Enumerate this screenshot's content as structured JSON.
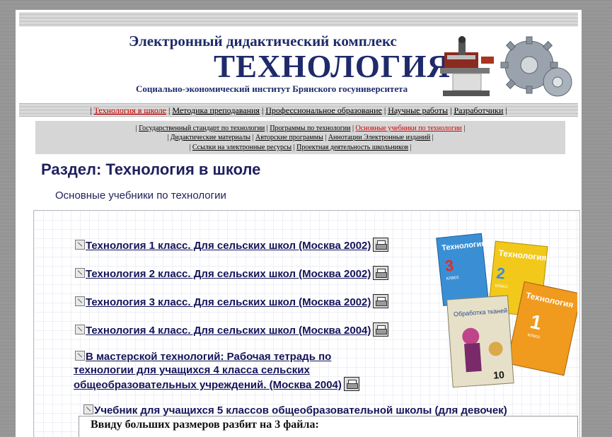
{
  "header": {
    "complex_title": "Электронный дидактический комплекс",
    "main_title": "ТЕХНОЛОГИЯ",
    "institute": "Социально-экономический институт Брянского госуниверситета"
  },
  "top_nav": {
    "items": [
      {
        "label": "Технология в школе",
        "active": true
      },
      {
        "label": "Методика преподавания",
        "active": false
      },
      {
        "label": "Профессиональное образование",
        "active": false
      },
      {
        "label": "Научные работы",
        "active": false
      },
      {
        "label": "Разработчики",
        "active": false
      }
    ]
  },
  "sub_nav": {
    "items": [
      {
        "label": "Государственный стандарт по технологии",
        "active": false
      },
      {
        "label": "Программы по технологии",
        "active": false
      },
      {
        "label": "Основные учебники по технологии",
        "active": true
      },
      {
        "label": "Дидактические материалы",
        "active": false
      },
      {
        "label": "Авторские программы",
        "active": false
      },
      {
        "label": "Аннотации Электронные изданий",
        "active": false
      },
      {
        "label": "Ссылки на электронные ресурсы",
        "active": false
      },
      {
        "label": "Проектная деятельность школьников",
        "active": false
      }
    ]
  },
  "section_title": "Раздел: Технология в школе",
  "subsection_title": "Основные учебники по технологии",
  "books": [
    {
      "title": "Технология 1 класс. Для сельских школ (Москва 2002)"
    },
    {
      "title": "Технология 2 класс. Для сельских школ (Москва 2002)"
    },
    {
      "title": "Технология 3 класс. Для сельских школ (Москва 2002)"
    },
    {
      "title": "Технология 4 класс. Для сельских школ (Москва 2004)"
    },
    {
      "title_lines": [
        "В мастерской технологий: Рабочая тетрадь по",
        "технологии для учащихся 4 класса сельских",
        "общеобразовательных учреждений. (Москва 2004)"
      ]
    },
    {
      "title": "Учебник для учащихся 5 классов общеобразовательной школы (для девочек)"
    }
  ],
  "note": "Ввиду больших размеров разбит на 3 файла:",
  "book_covers": {
    "brand": "Технология",
    "grades": [
      "3",
      "2",
      "1"
    ],
    "grade_word": "класс",
    "cover_text": "Обработка тканей",
    "badge": "10"
  },
  "colors": {
    "navy": "#1f2a6b",
    "link_active": "#cc0000",
    "subnav_bg": "#d6d6d6",
    "cover_blue": "#3a8fd4",
    "cover_yellow": "#f2c81b",
    "cover_orange": "#f09a1e"
  },
  "icons": [
    "link-arrow-icon",
    "print-icon",
    "gear-icon",
    "machine-tool-icon"
  ]
}
